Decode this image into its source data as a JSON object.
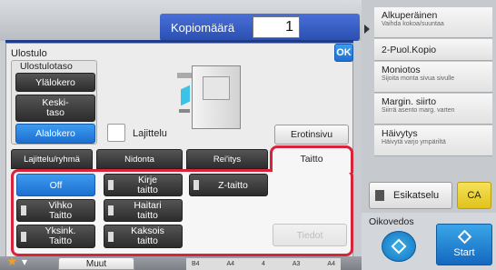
{
  "header": {
    "copies_label": "Kopiomäärä",
    "copies_value": "1"
  },
  "right_panel": {
    "original": {
      "title": "Alkuperäinen",
      "sub": "Vaihda kokoa/suuntaa"
    },
    "duplex": {
      "title": "2-Puol.Kopio"
    },
    "multiple": {
      "title": "Moniotos",
      "sub": "Sijoita monta sivua sivulle"
    },
    "margin": {
      "title": "Margin. siirto",
      "sub": "Siirrä asento marg. varten"
    },
    "erase": {
      "title": "Häivytys",
      "sub": "Häivytä varjo ympäriltä"
    },
    "preview_label": "Esikatselu",
    "ca_label": "CA",
    "standby_label": "Oikovedos",
    "start_label": "Start"
  },
  "dialog": {
    "title": "Ulostulo",
    "ok_label": "OK",
    "tray_group_label": "Ulostulotaso",
    "trays": [
      "Ylälokero",
      "Keski-\ntaso",
      "Alalokero"
    ],
    "sort_label": "Lajittelu",
    "separator_label": "Erotinsivu",
    "tabs": [
      "Lajittelu/ryhmä",
      "Nidonta",
      "Rei'itys",
      "Taitto"
    ],
    "fold": {
      "off": "Off",
      "letter": "Kirje\ntaitto",
      "z": "Z-taitto",
      "booklet": "Vihko\nTaitto",
      "gate": "Haitari\ntaitto",
      "single": "Yksink.\nTaitto",
      "double": "Kaksois\ntaitto",
      "details": "Tiedot"
    }
  },
  "bottom": {
    "other_label": "Muut",
    "labels": [
      "B4",
      "A4",
      "4",
      "A3",
      "A4"
    ]
  }
}
